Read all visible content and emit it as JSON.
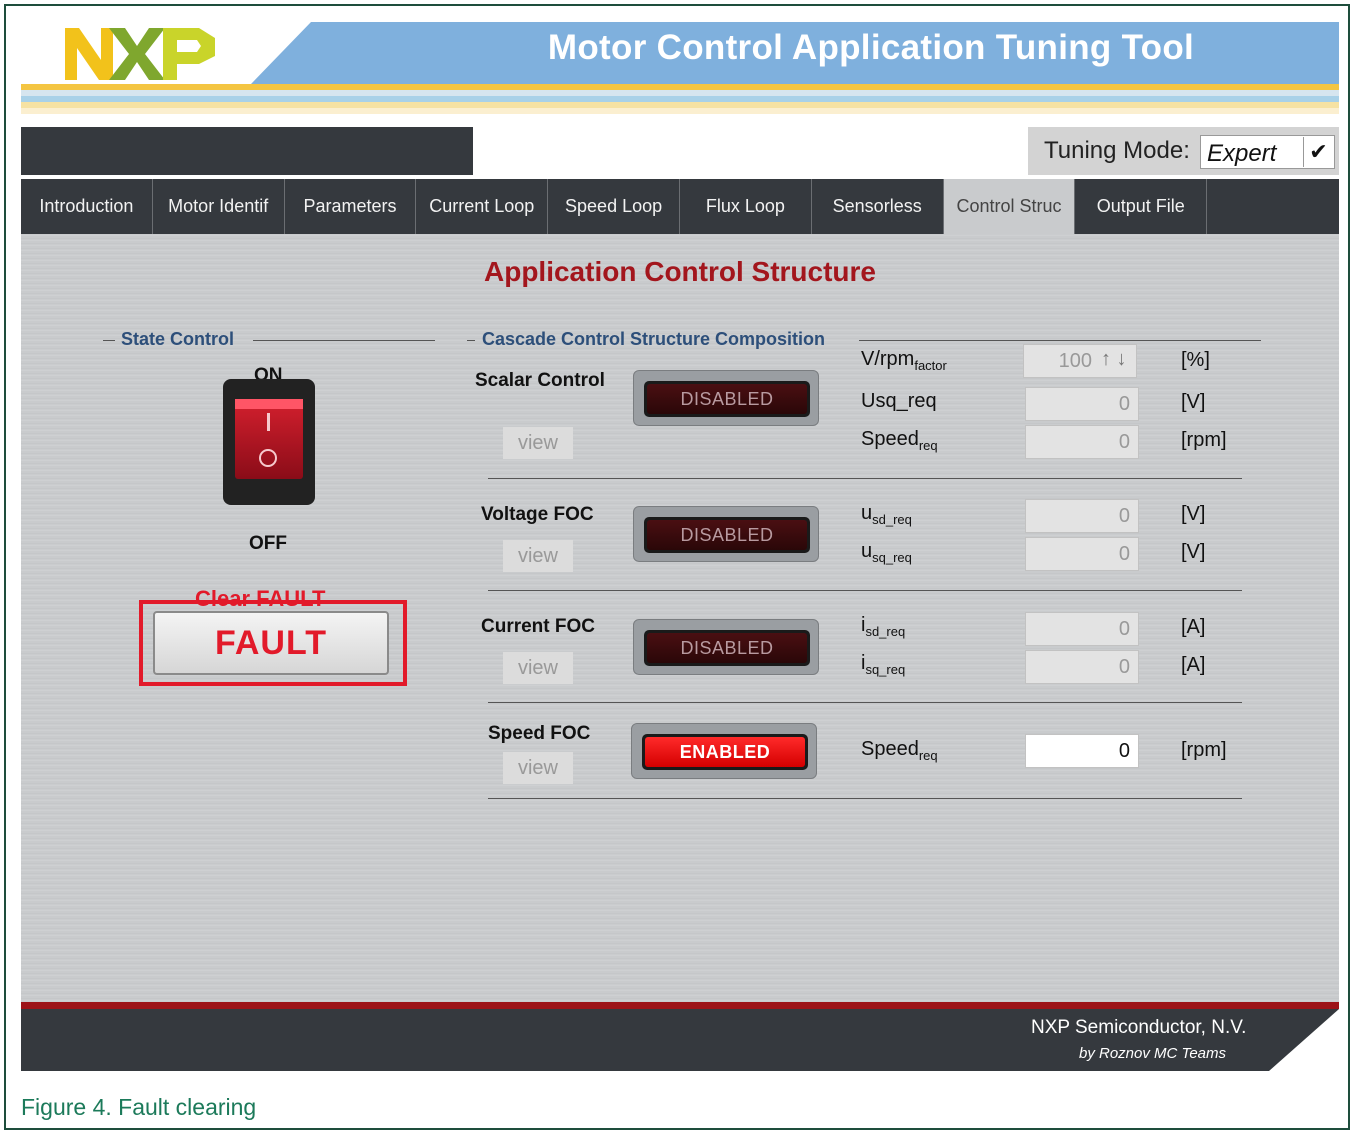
{
  "header": {
    "logo_text": "NXP",
    "title": "Motor Control Application Tuning Tool"
  },
  "colors": {
    "accent_red": "#a3161d",
    "tab_bar": "#35393e",
    "header_blue": "#7fb0dd",
    "caption_green": "#1c7a5a",
    "stripes": [
      "#f4c542",
      "#d6e5ef",
      "#a9d1e8",
      "#f6e2a3",
      "#fbefd0",
      "#ffffff"
    ]
  },
  "tuning_mode": {
    "label": "Tuning Mode:",
    "value": "Expert"
  },
  "tabs": [
    {
      "label": "Introduction",
      "active": false
    },
    {
      "label": "Motor Identif",
      "active": false
    },
    {
      "label": "Parameters",
      "active": false
    },
    {
      "label": "Current Loop",
      "active": false
    },
    {
      "label": "Speed Loop",
      "active": false
    },
    {
      "label": "Flux Loop",
      "active": false
    },
    {
      "label": "Sensorless",
      "active": false
    },
    {
      "label": "Control Struc",
      "active": true
    },
    {
      "label": "Output File",
      "active": false
    }
  ],
  "content": {
    "title": "Application Control Structure",
    "state_control": {
      "heading": "State Control",
      "on_label": "ON",
      "off_label": "OFF",
      "clear_fault_label": "Clear FAULT",
      "fault_button": "FAULT"
    },
    "cascade": {
      "heading": "Cascade Control Structure Composition",
      "view_label": "view",
      "blocks": {
        "scalar": {
          "name": "Scalar Control",
          "status": "DISABLED",
          "vrpm": {
            "label": "V/rpm",
            "sub": "factor",
            "value": "100",
            "unit": "[%]",
            "arrows": "↑ ↓"
          },
          "usq": {
            "label": "Usq_req",
            "value": "0",
            "unit": "[V]"
          },
          "speed": {
            "label": "Speed",
            "sub": "req",
            "value": "0",
            "unit": "[rpm]"
          }
        },
        "voltage": {
          "name": "Voltage FOC",
          "status": "DISABLED",
          "usd": {
            "label": "u",
            "sub": "sd_req",
            "value": "0",
            "unit": "[V]"
          },
          "usq": {
            "label": "u",
            "sub": "sq_req",
            "value": "0",
            "unit": "[V]"
          }
        },
        "current": {
          "name": "Current FOC",
          "status": "DISABLED",
          "isd": {
            "label": "i",
            "sub": "sd_req",
            "value": "0",
            "unit": "[A]"
          },
          "isq": {
            "label": "i",
            "sub": "sq_req",
            "value": "0",
            "unit": "[A]"
          }
        },
        "speedfoc": {
          "name": "Speed FOC",
          "status": "ENABLED",
          "speed": {
            "label": "Speed",
            "sub": "req",
            "value": "0",
            "unit": "[rpm]"
          }
        }
      }
    }
  },
  "footer": {
    "company": "NXP Semiconductor, N.V.",
    "team": "by Roznov MC Teams"
  },
  "caption": "Figure 4.  Fault clearing"
}
